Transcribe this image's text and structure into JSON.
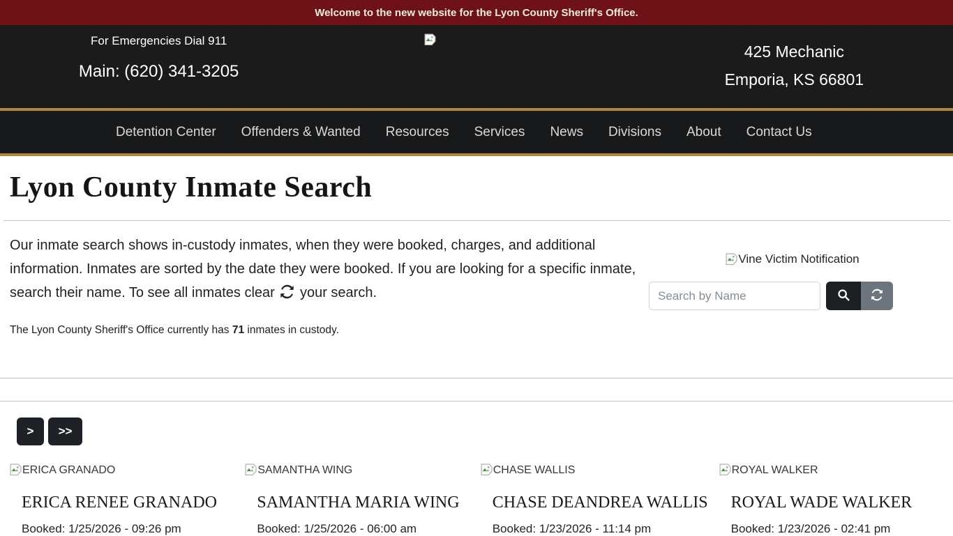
{
  "banner": {
    "text": "Welcome to the new website for the Lyon County Sheriff's Office."
  },
  "header": {
    "emergency_text": "For Emergencies Dial 911",
    "phone": "Main: (620) 341-3205",
    "address_line1": "425 Mechanic",
    "address_line2": "Emporia, KS 66801"
  },
  "nav": {
    "items": [
      "Detention Center",
      "Offenders & Wanted",
      "Resources",
      "Services",
      "News",
      "Divisions",
      "About",
      "Contact Us"
    ]
  },
  "page": {
    "title": "Lyon County Inmate Search",
    "intro_before_icon": "Our inmate search shows in-custody inmates, when they were booked, charges, and additional information. Inmates are sorted by the date they were booked. If you are looking for a specific inmate, search their name. To see all inmates clear",
    "intro_after_icon": "your search.",
    "custody_before": "The Lyon County Sheriff's Office currently has ",
    "custody_count": "71",
    "custody_after": " inmates in custody."
  },
  "vine": {
    "alt_text": "Vine Victim Notification"
  },
  "search": {
    "placeholder": "Search by Name"
  },
  "pagination": {
    "next_label": ">",
    "last_label": ">>"
  },
  "inmates": [
    {
      "photo_alt": "ERICA GRANADO",
      "name": "ERICA RENEE GRANADO",
      "booked": "Booked: 1/25/2026 - 09:26 pm"
    },
    {
      "photo_alt": "SAMANTHA WING",
      "name": "SAMANTHA MARIA WING",
      "booked": "Booked: 1/25/2026 - 06:00 am"
    },
    {
      "photo_alt": "CHASE WALLIS",
      "name": "CHASE DEANDREA WALLIS",
      "booked": "Booked: 1/23/2026 - 11:14 pm"
    },
    {
      "photo_alt": "ROYAL WALKER",
      "name": "ROYAL WADE WALKER",
      "booked": "Booked: 1/23/2026 - 02:41 pm"
    }
  ],
  "colors": {
    "banner_bg": "#6e1218",
    "gold_accent": "#a98a3d",
    "header_bg": "#1b1b1b",
    "nav_bg": "#17191b",
    "search_button_bg": "#1c2023",
    "refresh_button_bg": "#6c757d"
  }
}
